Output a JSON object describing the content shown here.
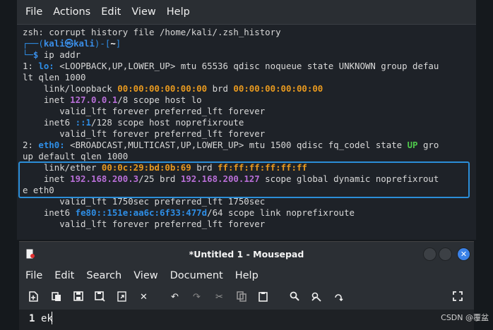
{
  "terminal": {
    "menu": [
      "File",
      "Actions",
      "Edit",
      "View",
      "Help"
    ],
    "lines": {
      "l1": "zsh: corrupt history file /home/kali/.zsh_history",
      "p1a": "┌──(",
      "p1user": "kali㉿kali",
      "p1b": ")-[",
      "p1dir": "~",
      "p1c": "]",
      "p2a": "└─",
      "p2b": "$ ",
      "cmd": "ip addr",
      "lo_num": "1: ",
      "lo_name": "lo:",
      "lo_rest": " <LOOPBACK,UP,LOWER_UP> mtu 65536 qdisc noqueue state UNKNOWN group defau",
      "lo_wrap": "lt qlen 1000",
      "lo_link_a": "    link/loopback ",
      "lo_mac": "00:00:00:00:00:00",
      "lo_brd": " brd ",
      "lo_brdmac": "00:00:00:00:00:00",
      "inet_a": "    inet ",
      "inet_ip": "127.0.0.1",
      "inet_b": "/8 scope host lo",
      "valid1": "       valid_lft forever preferred_lft forever",
      "inet6_a": "    inet6 ",
      "inet6_ip": "::1",
      "inet6_b": "/128 scope host noprefixroute",
      "valid2": "       valid_lft forever preferred_lft forever",
      "eth_num": "2: ",
      "eth_name": "eth0:",
      "eth_rest": " <BROADCAST,MULTICAST,UP,LOWER_UP> mtu 1500 qdisc fq_codel state ",
      "eth_up": "UP",
      "eth_tail": " gro",
      "eth_wrap": "up default qlen 1000",
      "ether_a": "    link/ether ",
      "ether_mac": "00:0c:29:bd:0b:69",
      "ether_brd": " brd ",
      "ether_brdmac": "ff:ff:ff:ff:ff:ff",
      "inet2_a": "    inet ",
      "inet2_ip": "192.168.200.3",
      "inet2_b": "/25 brd ",
      "inet2_brd": "192.168.200.127",
      "inet2_c": " scope global dynamic noprefixrout",
      "inet2_wrap": "e eth0",
      "valid3": "       valid_lft 1750sec preferred_lft 1750sec",
      "inet62_a": "    inet6 ",
      "inet62_ip": "fe80::151e:aa6c:6f33:477d",
      "inet62_b": "/64 scope link noprefixroute",
      "valid4": "       valid_lft forever preferred_lft forever"
    }
  },
  "mousepad": {
    "title": "*Untitled 1 - Mousepad",
    "menu": [
      "File",
      "Edit",
      "Search",
      "View",
      "Document",
      "Help"
    ],
    "toolbar_icons": [
      "new-document-icon",
      "open-icon",
      "save-icon",
      "save-as-icon",
      "reload-icon",
      "close-icon",
      "undo-icon",
      "redo-icon",
      "cut-icon",
      "copy-icon",
      "paste-icon",
      "find-icon",
      "find-replace-icon",
      "goto-icon",
      "fullscreen-icon"
    ],
    "editor": {
      "line_number": "1",
      "text": "ek"
    }
  },
  "watermark": "CSDN @覆盆"
}
